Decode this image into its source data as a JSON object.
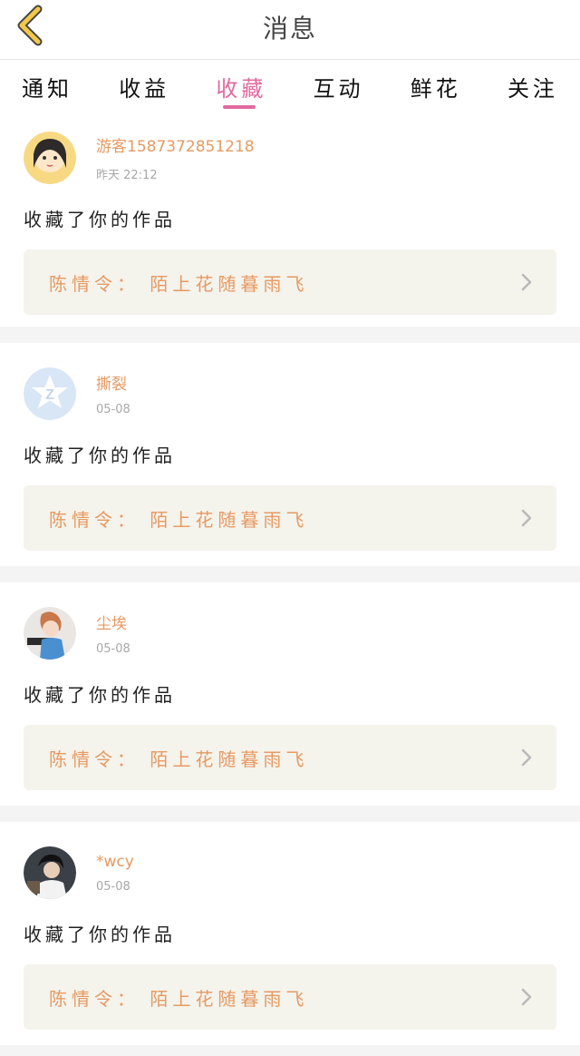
{
  "header": {
    "title": "消息"
  },
  "tabs": [
    {
      "label": "通知"
    },
    {
      "label": "收益"
    },
    {
      "label": "收藏"
    },
    {
      "label": "互动"
    },
    {
      "label": "鲜花"
    },
    {
      "label": "关注"
    }
  ],
  "active_tab": "收藏",
  "items": [
    {
      "username": "游客1587372851218",
      "time": "昨天  22:12",
      "action": "收藏了你的作品",
      "work": "陈情令：  陌上花随暮雨飞"
    },
    {
      "username": "撕裂",
      "time": "05-08",
      "action": "收藏了你的作品",
      "work": "陈情令：  陌上花随暮雨飞"
    },
    {
      "username": "尘埃",
      "time": "05-08",
      "action": "收藏了你的作品",
      "work": "陈情令：  陌上花随暮雨飞"
    },
    {
      "username": "*wcy",
      "time": "05-08",
      "action": "收藏了你的作品",
      "work": "陈情令：  陌上花随暮雨飞"
    }
  ],
  "colors": {
    "accent": "#e06aa0",
    "name": "#e69a62",
    "back_arrow": "#f3c84b"
  }
}
